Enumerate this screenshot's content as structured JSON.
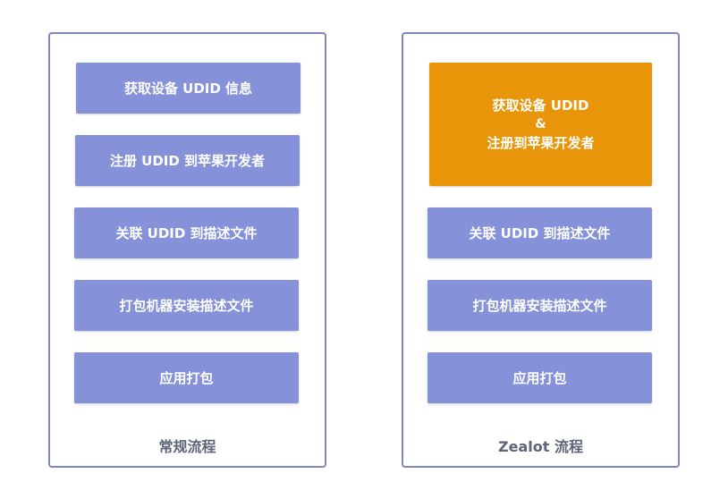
{
  "left_panel": {
    "title": "常规流程",
    "steps": [
      "获取设备 UDID 信息",
      "注册 UDID 到苹果开发者",
      "关联 UDID 到描述文件",
      "打包机器安装描述文件",
      "应用打包"
    ]
  },
  "right_panel": {
    "title": "Zealot 流程",
    "combined_step": {
      "line1": "获取设备 UDID",
      "line2": "&",
      "line3": "注册到苹果开发者"
    },
    "steps": [
      "关联 UDID 到描述文件",
      "打包机器安装描述文件",
      "应用打包"
    ]
  },
  "colors": {
    "step_fill": "#8591d8",
    "highlight_fill": "#e8950a",
    "panel_border": "#7b86c3",
    "label_text": "#5d6577"
  }
}
